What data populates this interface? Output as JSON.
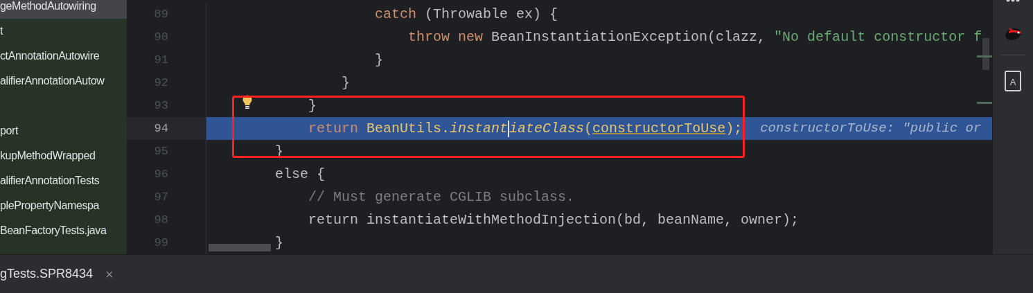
{
  "project_tree": {
    "items": [
      {
        "kind": "file",
        "label": "geMethodAutowiring",
        "selected": true
      },
      {
        "kind": "file",
        "label": "t",
        "selected": false
      },
      {
        "kind": "file",
        "label": "ctAnnotationAutowire",
        "selected": false
      },
      {
        "kind": "file",
        "label": "alifierAnnotationAutow",
        "selected": false
      },
      {
        "kind": "spacer"
      },
      {
        "kind": "file",
        "label": "port",
        "selected": false
      },
      {
        "kind": "file",
        "label": "kupMethodWrapped",
        "selected": false
      },
      {
        "kind": "file",
        "label": "alifierAnnotationTests",
        "selected": false
      },
      {
        "kind": "file",
        "label": "plePropertyNamespa",
        "selected": false
      },
      {
        "kind": "file",
        "label": "BeanFactoryTests.java",
        "selected": false
      }
    ]
  },
  "editor": {
    "lines": [
      {
        "children": [
          {
            "children": [
              {
                "children": [
                  {
                    "line": {
                      "number": "89",
                      "current": false,
                      "bulb": false,
                      "tokens": [
                        {
                          "kind": "keyword",
                          "text": "catch"
                        },
                        {
                          "kind": "plain",
                          "text": " (Throwable ex) {"
                        }
                      ]
                    },
                    "children": [
                      {
                        "line": {
                          "number": "90",
                          "current": false,
                          "bulb": false,
                          "tokens": [
                            {
                              "kind": "keyword",
                              "text": "throw new"
                            },
                            {
                              "kind": "plain",
                              "text": " BeanInstantiationException(clazz, "
                            },
                            {
                              "kind": "string",
                              "text": "\"No default constructor f"
                            }
                          ]
                        }
                      }
                    ]
                  },
                  {
                    "line": {
                      "number": "91",
                      "current": false,
                      "bulb": false,
                      "tokens": [
                        {
                          "kind": "plain",
                          "text": "}"
                        }
                      ]
                    }
                  }
                ]
              },
              {
                "line": {
                  "number": "92",
                  "current": false,
                  "bulb": false,
                  "tokens": [
                    {
                      "kind": "plain",
                      "text": "}"
                    }
                  ]
                }
              }
            ]
          },
          {
            "line": {
              "number": "93",
              "current": false,
              "bulb": true,
              "tokens": [
                {
                  "kind": "plain",
                  "text": "}"
                }
              ]
            }
          },
          {
            "line": {
              "number": "94",
              "current": true,
              "bulb": false,
              "tokens": [
                {
                  "kind": "keyword",
                  "text": "return"
                },
                {
                  "kind": "exec",
                  "text": " BeanUtils."
                },
                {
                  "kind": "method",
                  "text": "instant"
                },
                {
                  "kind": "caret"
                },
                {
                  "kind": "method",
                  "text": "iateClass"
                },
                {
                  "kind": "exec",
                  "text": "("
                },
                {
                  "kind": "param",
                  "text": "constructorToUse"
                },
                {
                  "kind": "exec",
                  "text": ");"
                },
                {
                  "kind": "hint",
                  "text": "constructorToUse: \"public or"
                }
              ]
            }
          }
        ]
      },
      {
        "line": {
          "number": "95",
          "current": false,
          "bulb": false,
          "tokens": [
            {
              "kind": "plain",
              "text": "}"
            }
          ]
        }
      },
      {
        "line": {
          "number": "96",
          "current": false,
          "bulb": false,
          "tokens": [
            {
              "kind": "plain",
              "text": "else {"
            }
          ]
        },
        "children": [
          {
            "line": {
              "number": "97",
              "current": false,
              "bulb": false,
              "tokens": [
                {
                  "kind": "comment",
                  "text": "// Must generate CGLIB subclass."
                }
              ]
            }
          },
          {
            "line": {
              "number": "98",
              "current": false,
              "bulb": false,
              "tokens": [
                {
                  "kind": "plain",
                  "text": "return instantiateWithMethodInjection(bd, beanName, owner);"
                }
              ]
            }
          }
        ]
      },
      {
        "line": {
          "number": "99",
          "current": false,
          "bulb": false,
          "tokens": [
            {
              "kind": "plain",
              "text": "}"
            }
          ]
        }
      }
    ]
  },
  "right_toolbar": {
    "book_letter": "A"
  },
  "bottom_tabs": [
    {
      "label": "gTests.SPR8434",
      "close": "×"
    }
  ]
}
